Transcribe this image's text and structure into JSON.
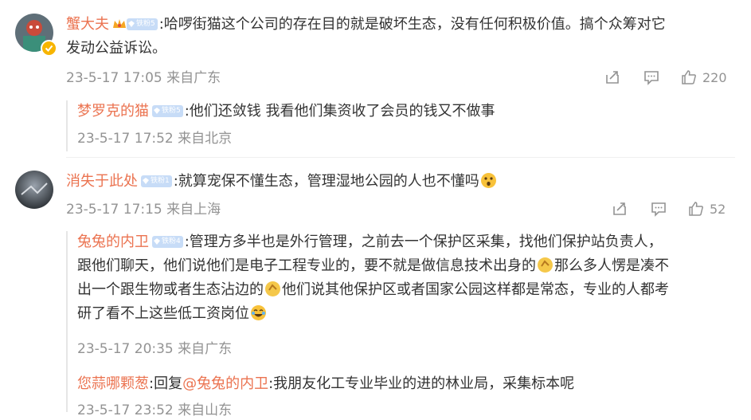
{
  "comments": [
    {
      "author": "蟹大夫",
      "badge": "铁粉5",
      "text_line1": ":哈啰街猫这个公司的存在目的就是破坏生态，没有任何积极价值。搞个众筹对它",
      "text_line2": "发动公益诉讼。",
      "meta": "23-5-17 17:05 来自广东",
      "likes": "220",
      "reply": {
        "author": "梦罗克的猫",
        "badge": "铁粉5",
        "text": ":他们还敛钱 我看他们集资收了会员的钱又不做事",
        "meta": "23-5-17 17:52 来自北京"
      }
    },
    {
      "author": "消失于此处",
      "badge": "铁粉1",
      "text": ":就算宠保不懂生态，管理湿地公园的人也不懂吗",
      "meta": "23-5-17 17:15 来自上海",
      "likes": "52",
      "replies": [
        {
          "author": "兔兔的内卫",
          "badge": "铁粉4",
          "line1": ":管理方多半也是外行管理，之前去一个保护区采集，找他们保护站负责人，",
          "line2a": "跟他们聊天，他们说他们是电子工程专业的，要不就是做信息技术出身的",
          "line2b": "那么多人愣是凑不",
          "line3a": "出一个跟生物或者生态沾边的",
          "line3b": "他们说其他保护区或者国家公园这样都是常态，专业的人都考",
          "line4": "研了看不上这些低工资岗位",
          "meta": "23-5-17 20:35 来自广东"
        },
        {
          "author": "您蒜哪颗葱",
          "reply_word": ":回复",
          "mention": "@兔兔的内卫",
          "text": ":我朋友化工专业毕业的进的林业局，采集标本呢",
          "meta": "23-5-17 23:52 来自山东"
        }
      ]
    }
  ],
  "icons": [
    "share-icon",
    "comment-icon",
    "like-icon",
    "diamond-badge-icon",
    "crown-icon",
    "emoji-icon"
  ],
  "colors": {
    "name": "#eb7350",
    "meta": "#939393",
    "text": "#333333",
    "badge": "#c7dcf7"
  }
}
